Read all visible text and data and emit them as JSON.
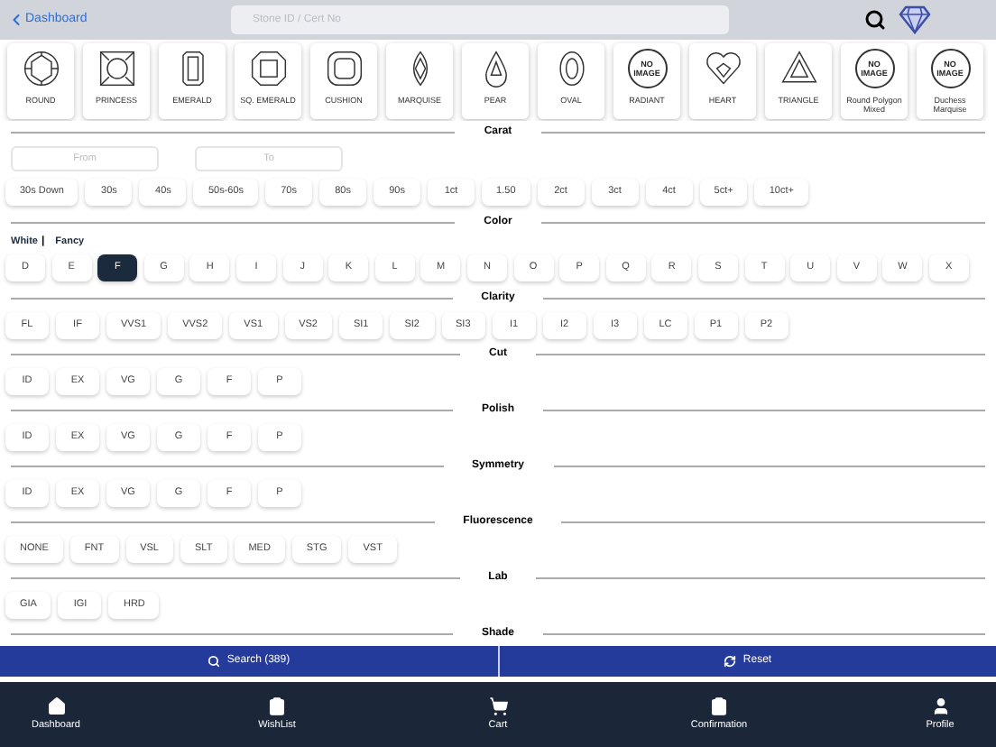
{
  "header": {
    "back_label": "Dashboard",
    "search": {
      "placeholder": "Stone ID / Cert No"
    }
  },
  "shapes": [
    {
      "kind": "round",
      "label": "ROUND"
    },
    {
      "kind": "princess",
      "label": "PRINCESS"
    },
    {
      "kind": "emerald",
      "label": "EMERALD"
    },
    {
      "kind": "sq_emerald",
      "label": "SQ. EMERALD"
    },
    {
      "kind": "cushion",
      "label": "CUSHION"
    },
    {
      "kind": "marquise",
      "label": "MARQUISE"
    },
    {
      "kind": "pear",
      "label": "PEAR"
    },
    {
      "kind": "oval",
      "label": "OVAL"
    },
    {
      "kind": "no_image",
      "label": "RADIANT",
      "badge_text": "NO IMAGE"
    },
    {
      "kind": "heart",
      "label": "HEART"
    },
    {
      "kind": "triangle",
      "label": "TRIANGLE"
    },
    {
      "kind": "no_image",
      "label": "Round Polygon Mixed",
      "badge_text": "NO IMAGE"
    },
    {
      "kind": "no_image",
      "label": "Duchess Marquise",
      "badge_text": "NO IMAGE"
    }
  ],
  "carat": {
    "title": "Carat",
    "from": {
      "placeholder": "From"
    },
    "to": {
      "placeholder": "To"
    },
    "options": [
      {
        "label": "30s Down",
        "selected": false
      },
      {
        "label": "30s",
        "selected": false
      },
      {
        "label": "40s",
        "selected": false
      },
      {
        "label": "50s-60s",
        "selected": false
      },
      {
        "label": "70s",
        "selected": false
      },
      {
        "label": "80s",
        "selected": false
      },
      {
        "label": "90s",
        "selected": false
      },
      {
        "label": "1ct",
        "selected": false
      },
      {
        "label": "1.50",
        "selected": false
      },
      {
        "label": "2ct",
        "selected": false
      },
      {
        "label": "3ct",
        "selected": false
      },
      {
        "label": "4ct",
        "selected": false
      },
      {
        "label": "5ct+",
        "selected": false
      },
      {
        "label": "10ct+",
        "selected": false
      }
    ]
  },
  "color": {
    "title": "Color",
    "modes": [
      "White",
      "Fancy"
    ],
    "separator": "|",
    "options": [
      {
        "label": "D",
        "selected": false
      },
      {
        "label": "E",
        "selected": false
      },
      {
        "label": "F",
        "selected": true
      },
      {
        "label": "G",
        "selected": false
      },
      {
        "label": "H",
        "selected": false
      },
      {
        "label": "I",
        "selected": false
      },
      {
        "label": "J",
        "selected": false
      },
      {
        "label": "K",
        "selected": false
      },
      {
        "label": "L",
        "selected": false
      },
      {
        "label": "M",
        "selected": false
      },
      {
        "label": "N",
        "selected": false
      },
      {
        "label": "O",
        "selected": false
      },
      {
        "label": "P",
        "selected": false
      },
      {
        "label": "Q",
        "selected": false
      },
      {
        "label": "R",
        "selected": false
      },
      {
        "label": "S",
        "selected": false
      },
      {
        "label": "T",
        "selected": false
      },
      {
        "label": "U",
        "selected": false
      },
      {
        "label": "V",
        "selected": false
      },
      {
        "label": "W",
        "selected": false
      },
      {
        "label": "X",
        "selected": false
      }
    ]
  },
  "sections": [
    {
      "title": "Clarity",
      "options": [
        {
          "label": "FL",
          "selected": false
        },
        {
          "label": "IF",
          "selected": false
        },
        {
          "label": "VVS1",
          "selected": false
        },
        {
          "label": "VVS2",
          "selected": false
        },
        {
          "label": "VS1",
          "selected": false
        },
        {
          "label": "VS2",
          "selected": false
        },
        {
          "label": "SI1",
          "selected": false
        },
        {
          "label": "SI2",
          "selected": false
        },
        {
          "label": "SI3",
          "selected": false
        },
        {
          "label": "I1",
          "selected": false
        },
        {
          "label": "I2",
          "selected": false
        },
        {
          "label": "I3",
          "selected": false
        },
        {
          "label": "LC",
          "selected": false
        },
        {
          "label": "P1",
          "selected": false
        },
        {
          "label": "P2",
          "selected": false
        }
      ]
    },
    {
      "title": "Cut",
      "options": [
        {
          "label": "ID",
          "selected": false
        },
        {
          "label": "EX",
          "selected": false
        },
        {
          "label": "VG",
          "selected": false
        },
        {
          "label": "G",
          "selected": false
        },
        {
          "label": "F",
          "selected": false
        },
        {
          "label": "P",
          "selected": false
        }
      ]
    },
    {
      "title": "Polish",
      "options": [
        {
          "label": "ID",
          "selected": false
        },
        {
          "label": "EX",
          "selected": false
        },
        {
          "label": "VG",
          "selected": false
        },
        {
          "label": "G",
          "selected": false
        },
        {
          "label": "F",
          "selected": false
        },
        {
          "label": "P",
          "selected": false
        }
      ]
    },
    {
      "title": "Symmetry",
      "options": [
        {
          "label": "ID",
          "selected": false
        },
        {
          "label": "EX",
          "selected": false
        },
        {
          "label": "VG",
          "selected": false
        },
        {
          "label": "G",
          "selected": false
        },
        {
          "label": "F",
          "selected": false
        },
        {
          "label": "P",
          "selected": false
        }
      ]
    },
    {
      "title": "Fluorescence",
      "options": [
        {
          "label": "NONE",
          "selected": false
        },
        {
          "label": "FNT",
          "selected": false
        },
        {
          "label": "VSL",
          "selected": false
        },
        {
          "label": "SLT",
          "selected": false
        },
        {
          "label": "MED",
          "selected": false
        },
        {
          "label": "STG",
          "selected": false
        },
        {
          "label": "VST",
          "selected": false
        }
      ]
    },
    {
      "title": "Lab",
      "options": [
        {
          "label": "GIA",
          "selected": false
        },
        {
          "label": "IGI",
          "selected": false
        },
        {
          "label": "HRD",
          "selected": false
        }
      ]
    },
    {
      "title": "Shade"
    }
  ],
  "actions": {
    "search": "Search (389)",
    "reset": "Reset"
  },
  "nav": [
    {
      "kind": "home",
      "label": "Dashboard"
    },
    {
      "kind": "wishlist",
      "label": "WishList"
    },
    {
      "kind": "cart",
      "label": "Cart"
    },
    {
      "kind": "confirmation",
      "label": "Confirmation"
    },
    {
      "kind": "profile",
      "label": "Profile"
    }
  ]
}
